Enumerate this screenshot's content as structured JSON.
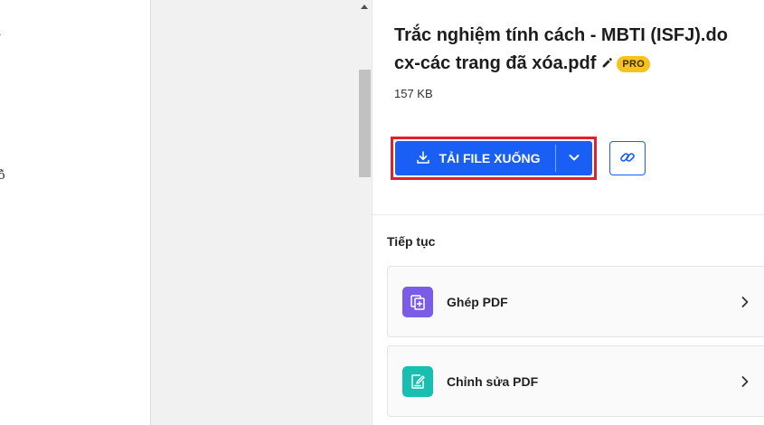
{
  "document": {
    "fragment_top": "-",
    "fragment_mid": "ỗ"
  },
  "file": {
    "name": "Trắc nghiệm tính cách - MBTI (ISFJ).docx-các trang đã xóa.pdf",
    "badge": "PRO",
    "size": "157 KB"
  },
  "download": {
    "label": "TẢI FILE XUỐNG"
  },
  "continue": {
    "title": "Tiếp tục",
    "tools": [
      {
        "label": "Ghép PDF",
        "icon": "merge-pdf-icon",
        "color": "#7b5ce6"
      },
      {
        "label": "Chỉnh sửa PDF",
        "icon": "edit-pdf-icon",
        "color": "#18bfb0"
      }
    ]
  },
  "colors": {
    "accent": "#1a5ff5",
    "highlight": "#e0202a",
    "badge": "#f8c21c"
  }
}
